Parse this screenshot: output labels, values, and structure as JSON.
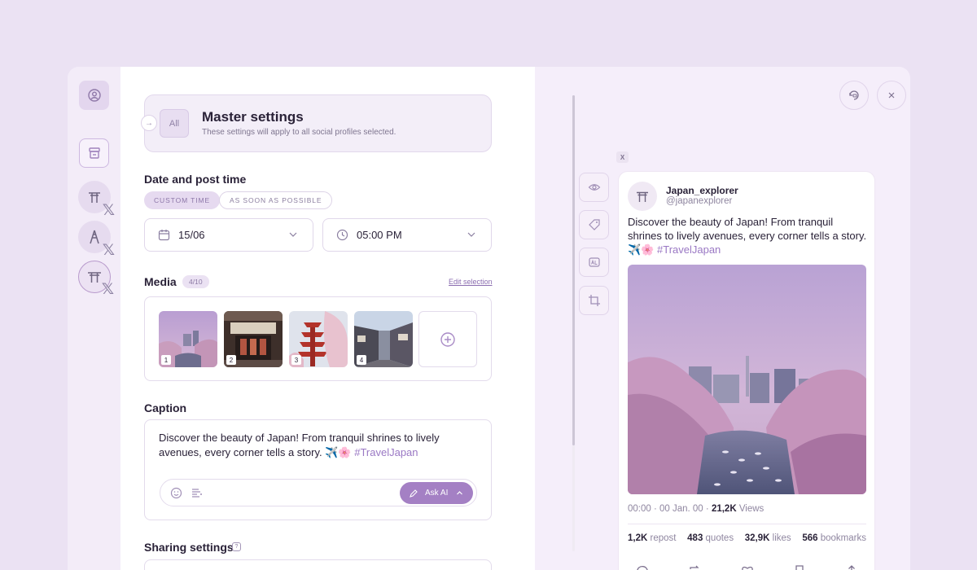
{
  "master": {
    "all_label": "All",
    "title": "Master settings",
    "description": "These settings will apply to all social profiles selected."
  },
  "date_section": {
    "title": "Date and post time",
    "custom_time": "CUSTOM TIME",
    "asap": "AS SOON AS POSSIBLE",
    "date_value": "15/06",
    "time_value": "05:00 PM"
  },
  "media": {
    "title": "Media",
    "count": "4/10",
    "edit_link": "Edit selection",
    "thumbs": [
      "1",
      "2",
      "3",
      "4"
    ]
  },
  "caption": {
    "title": "Caption",
    "text": "Discover the beauty of Japan! From tranquil shrines to lively avenues, every corner tells a story. ✈️🌸 ",
    "hashtag": "#TravelJapan",
    "ask_ai": "Ask AI"
  },
  "sharing": {
    "title": "Sharing settings",
    "help": "?"
  },
  "preview": {
    "network_badge": "X",
    "account_name": "Japan_explorer",
    "account_handle": "@japanexplorer",
    "post_text": "Discover the beauty of Japan! From tranquil shrines to lively avenues, every corner tells a story. ✈️🌸 ",
    "hashtag": "#TravelJapan",
    "time": "00:00 · 00 Jan. 00 · ",
    "views_count": "21,2K",
    "views_label": " Views",
    "reposts_count": "1,2K",
    "reposts_label": " repost",
    "quotes_count": "483",
    "quotes_label": " quotes",
    "likes_count": "32,9K",
    "likes_label": " likes",
    "bookmarks_count": "566",
    "bookmarks_label": " bookmarks"
  },
  "colors": {
    "accent": "#a480c4",
    "background": "#ebe2f3",
    "hashtag": "#9a78c4"
  }
}
